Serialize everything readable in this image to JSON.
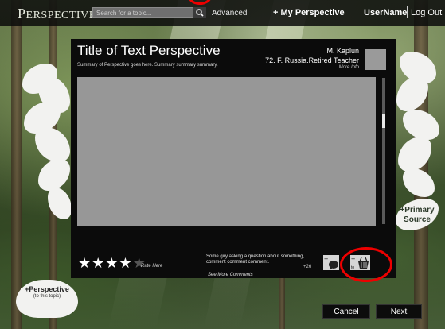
{
  "topbar": {
    "logo_first": "P",
    "logo_rest": "ERSPECTIVE",
    "search_placeholder": "Search for a topic...",
    "advanced_label": "Advanced",
    "my_perspective_label": "+ My Perspective",
    "username_label": "UserName",
    "logout_label": "Log Out"
  },
  "panel": {
    "title": "Title of Text Perspective",
    "summary": "Summary of Perspective goes here. Summary summary summary.",
    "author_name": "M. Kaplun",
    "author_details": "72. F. Russia.Retired Teacher",
    "more_info": "More Info",
    "rating": {
      "filled": 4,
      "total": 5
    },
    "rate_here": "Rate Here",
    "comment_text": "Some guy asking a question about something, comment comment comment.",
    "comment_count": "+26",
    "see_more_comments": "See More Comments",
    "basket_caption": "to"
  },
  "side": {
    "primary_source": "+Primary Source",
    "plus_perspective": "+Perspective",
    "plus_perspective_sub": "(to this topic)"
  },
  "footer": {
    "cancel_label": "Cancel",
    "next_label": "Next"
  },
  "colors": {
    "annotation_red": "#ee0000",
    "panel_bg": "#0b0b0b",
    "content_gray": "#979797"
  },
  "icons": [
    "search-icon",
    "star-icon",
    "ask-question-icon",
    "basket-icon"
  ]
}
